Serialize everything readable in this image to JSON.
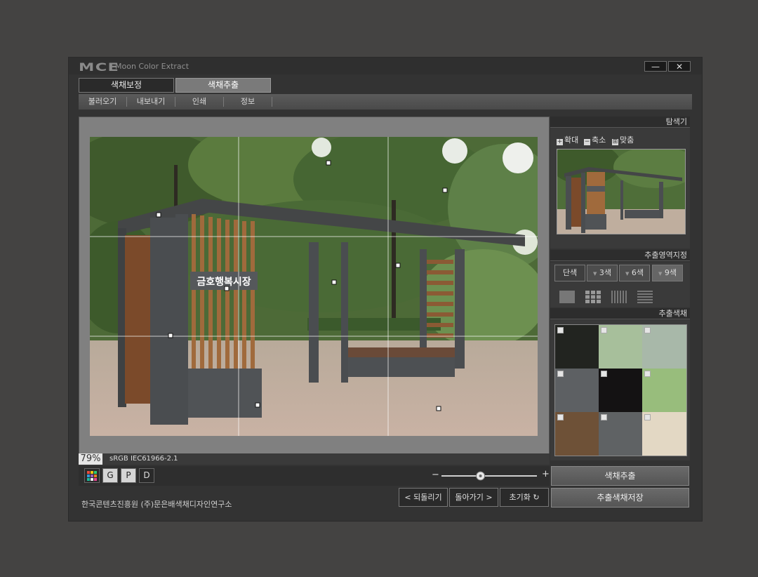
{
  "app": {
    "logo": "MCE",
    "title": "Moon Color Extract",
    "minimize": "—",
    "close": "✕"
  },
  "tabs": [
    "색채보정",
    "색채추출"
  ],
  "menu": [
    "불러오기",
    "내보내기",
    "인쇄",
    "정보"
  ],
  "image": {
    "sign_text": "금호행복시장"
  },
  "status": {
    "zoom": "79%",
    "profile": "sRGB IEC61966-2.1"
  },
  "tools": [
    {
      "name": "palette-tool",
      "label": ""
    },
    {
      "name": "g-tool",
      "label": "G"
    },
    {
      "name": "p-tool",
      "label": "P"
    },
    {
      "name": "d-tool",
      "label": "D"
    }
  ],
  "zoom_slider": {
    "minus": "−",
    "plus": "+",
    "value_fraction": 0.4
  },
  "footer": {
    "credit": "한국콘텐츠진흥원 (주)문은배색채디자인연구소"
  },
  "nav_buttons": {
    "undo": "< 되돌리기",
    "redo": "돌아가기 >",
    "reset": "초기화"
  },
  "navigator": {
    "title": "탐색기",
    "zoom_in_icon": "+",
    "zoom_in": "확대",
    "zoom_out_icon": "−",
    "zoom_out": "축소",
    "fit_icon": "⊞",
    "fit": "맞춤"
  },
  "extract_area": {
    "title": "추출영역지정",
    "options": [
      "단색",
      "3색",
      "6색",
      "9색"
    ],
    "selected": "9색"
  },
  "extracted_colors": {
    "title": "추출색채",
    "swatches": [
      "#222420",
      "#a7bf9b",
      "#a8b8a9",
      "#5d6063",
      "#141213",
      "#98bd7c",
      "#6e5137",
      "#5f6264",
      "#e3d8c4"
    ]
  },
  "buttons": {
    "extract": "색채추출",
    "save": "추출색채저장"
  }
}
